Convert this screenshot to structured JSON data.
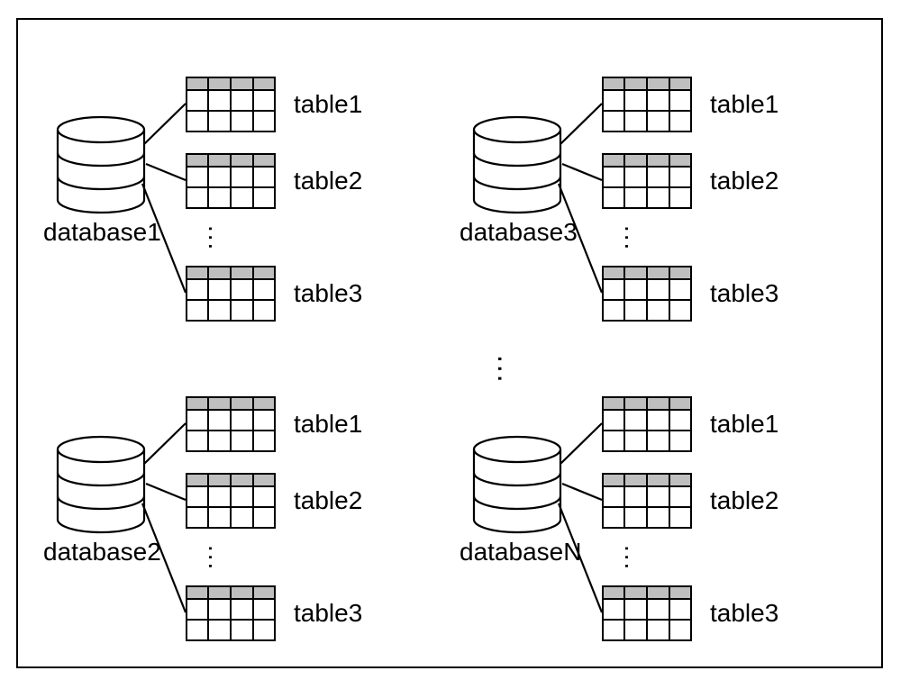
{
  "diagram": {
    "databases": [
      {
        "label": "database1",
        "tables": [
          "table1",
          "table2",
          "table3"
        ]
      },
      {
        "label": "database2",
        "tables": [
          "table1",
          "table2",
          "table3"
        ]
      },
      {
        "label": "database3",
        "tables": [
          "table1",
          "table2",
          "table3"
        ]
      },
      {
        "label": "databaseN",
        "tables": [
          "table1",
          "table2",
          "table3"
        ]
      }
    ],
    "ellipsis": "..."
  }
}
